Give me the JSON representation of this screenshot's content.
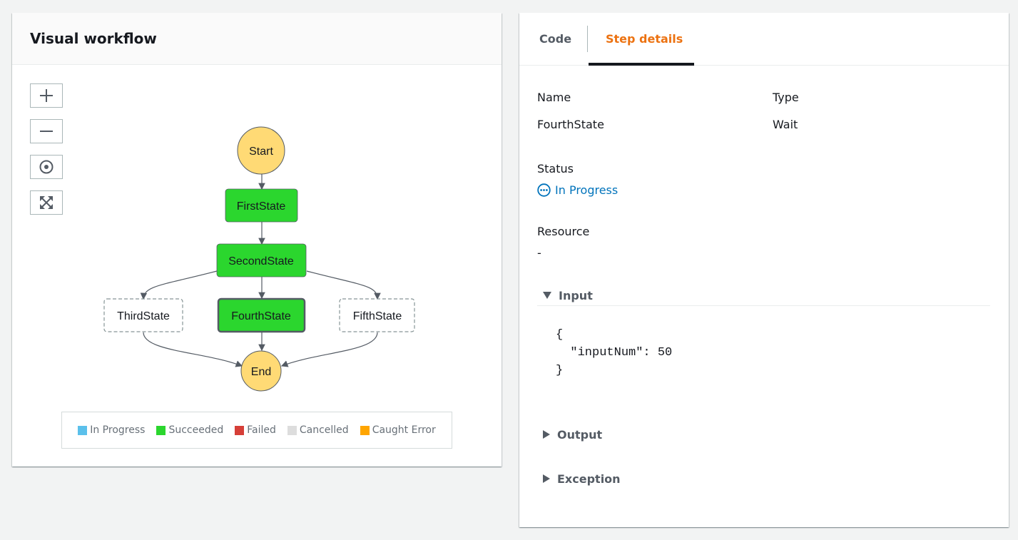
{
  "workflow": {
    "title": "Visual workflow",
    "nodes": {
      "start": "Start",
      "first": "FirstState",
      "second": "SecondState",
      "third": "ThirdState",
      "fourth": "FourthState",
      "fifth": "FifthState",
      "end": "End"
    },
    "legend": [
      {
        "label": "In Progress",
        "color": "#5bc0eb"
      },
      {
        "label": "Succeeded",
        "color": "#2bd62e"
      },
      {
        "label": "Failed",
        "color": "#d63f38"
      },
      {
        "label": "Cancelled",
        "color": "#dddddd"
      },
      {
        "label": "Caught Error",
        "color": "#ffa500"
      }
    ],
    "colors": {
      "start_end": "#ffda75",
      "succeeded": "#2bd62e"
    }
  },
  "tabs": {
    "code": "Code",
    "step_details": "Step details",
    "active_color": "#ec7211"
  },
  "step": {
    "name_label": "Name",
    "name_value": "FourthState",
    "type_label": "Type",
    "type_value": "Wait",
    "status_label": "Status",
    "status_value": "In Progress",
    "resource_label": "Resource",
    "resource_value": "-",
    "input_label": "Input",
    "input_code": "{\n  \"inputNum\": 50\n}",
    "output_label": "Output",
    "exception_label": "Exception"
  }
}
